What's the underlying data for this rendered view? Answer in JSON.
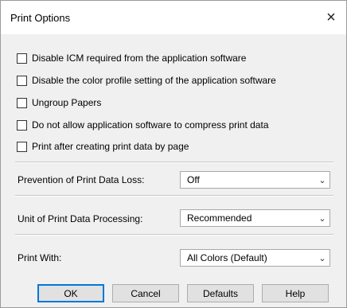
{
  "dialog": {
    "title": "Print Options",
    "close_glyph": "×"
  },
  "checkboxes": [
    {
      "label": "Disable ICM required from the application software",
      "checked": false
    },
    {
      "label": "Disable the color profile setting of the application software",
      "checked": false
    },
    {
      "label": "Ungroup Papers",
      "checked": false
    },
    {
      "label": "Do not allow application software to compress print data",
      "checked": false
    },
    {
      "label": "Print after creating print data by page",
      "checked": false
    }
  ],
  "settings": {
    "data_loss": {
      "label": "Prevention of Print Data Loss:",
      "value": "Off"
    },
    "processing": {
      "label": "Unit of Print Data Processing:",
      "value": "Recommended"
    },
    "print_with": {
      "label": "Print With:",
      "value": "All Colors (Default)"
    }
  },
  "buttons": {
    "ok": "OK",
    "cancel": "Cancel",
    "defaults": "Defaults",
    "help": "Help"
  },
  "icons": {
    "dropdown": "chevron-down-icon",
    "close": "close-icon"
  }
}
